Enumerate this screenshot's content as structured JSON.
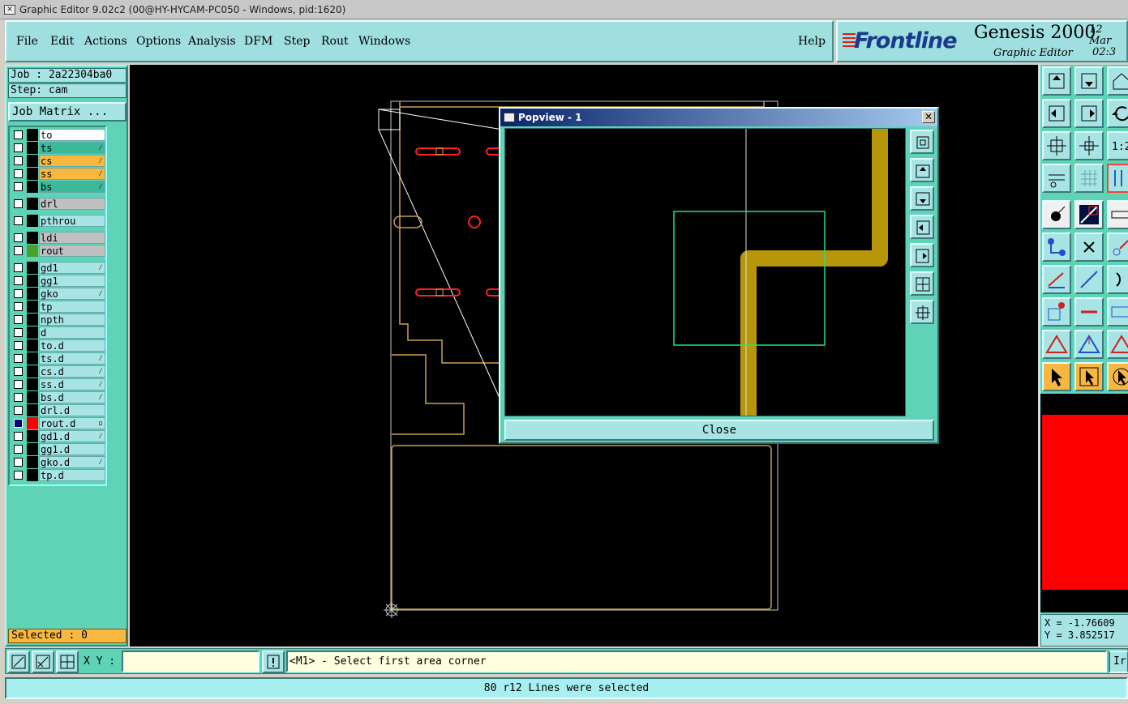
{
  "window": {
    "title": "Graphic Editor 9.02c2 (00@HY-HYCAM-PC050 - Windows, pid:1620)"
  },
  "menu": {
    "items": [
      "File",
      "Edit",
      "Actions",
      "Options",
      "Analysis",
      "DFM",
      "Step",
      "Rout",
      "Windows"
    ],
    "help": "Help"
  },
  "brand": {
    "logo": "Frontline",
    "product": "Genesis 2000",
    "subtitle": "Graphic Editor",
    "date_line1": "12 Mar",
    "date_line2": "02:3"
  },
  "job": {
    "job_label": "Job : 2a22304ba0",
    "step_label": "Step: cam",
    "job_matrix_button": "Job Matrix ..."
  },
  "layers": [
    {
      "name": "to",
      "color": "#000000",
      "bg": "#ffffff",
      "checked": false,
      "flag": ""
    },
    {
      "name": "ts",
      "color": "#000000",
      "bg": "#3cb89a",
      "checked": false,
      "flag": "⁄"
    },
    {
      "name": "cs",
      "color": "#000000",
      "bg": "#f8b840",
      "checked": false,
      "flag": "⁄"
    },
    {
      "name": "ss",
      "color": "#000000",
      "bg": "#f8b840",
      "checked": false,
      "flag": "⁄"
    },
    {
      "name": "bs",
      "color": "#000000",
      "bg": "#3cb89a",
      "checked": false,
      "flag": "⁄"
    },
    {
      "name": "drl",
      "color": "#000000",
      "bg": "#c0c0c0",
      "checked": false,
      "flag": ""
    },
    {
      "name": "pthrou",
      "color": "#000000",
      "bg": "#a8e4e4",
      "checked": false,
      "flag": ""
    },
    {
      "name": "ldi",
      "color": "#000000",
      "bg": "#c0c0c0",
      "checked": false,
      "flag": ""
    },
    {
      "name": "rout",
      "color": "#4aa02a",
      "bg": "#c0c0c0",
      "checked": false,
      "flag": ""
    },
    {
      "name": "gd1",
      "color": "#000000",
      "bg": "#a8e4e4",
      "checked": false,
      "flag": "⁄"
    },
    {
      "name": "gg1",
      "color": "#000000",
      "bg": "#a8e4e4",
      "checked": false,
      "flag": ""
    },
    {
      "name": "gko",
      "color": "#000000",
      "bg": "#a8e4e4",
      "checked": false,
      "flag": "⁄"
    },
    {
      "name": "tp",
      "color": "#000000",
      "bg": "#a8e4e4",
      "checked": false,
      "flag": ""
    },
    {
      "name": "npth",
      "color": "#000000",
      "bg": "#a8e4e4",
      "checked": false,
      "flag": ""
    },
    {
      "name": "d",
      "color": "#000000",
      "bg": "#a8e4e4",
      "checked": false,
      "flag": ""
    },
    {
      "name": "to.d",
      "color": "#000000",
      "bg": "#a8e4e4",
      "checked": false,
      "flag": ""
    },
    {
      "name": "ts.d",
      "color": "#000000",
      "bg": "#a8e4e4",
      "checked": false,
      "flag": "⁄"
    },
    {
      "name": "cs.d",
      "color": "#000000",
      "bg": "#a8e4e4",
      "checked": false,
      "flag": "⁄"
    },
    {
      "name": "ss.d",
      "color": "#000000",
      "bg": "#a8e4e4",
      "checked": false,
      "flag": "⁄"
    },
    {
      "name": "bs.d",
      "color": "#000000",
      "bg": "#a8e4e4",
      "checked": false,
      "flag": "⁄"
    },
    {
      "name": "drl.d",
      "color": "#000000",
      "bg": "#a8e4e4",
      "checked": false,
      "flag": ""
    },
    {
      "name": "rout.d",
      "color": "#ff0000",
      "bg": "#a8e4e4",
      "checked": true,
      "flag": "▫"
    },
    {
      "name": "gd1.d",
      "color": "#000000",
      "bg": "#a8e4e4",
      "checked": false,
      "flag": "⁄"
    },
    {
      "name": "gg1.d",
      "color": "#000000",
      "bg": "#a8e4e4",
      "checked": false,
      "flag": ""
    },
    {
      "name": "gko.d",
      "color": "#000000",
      "bg": "#a8e4e4",
      "checked": false,
      "flag": "⁄"
    },
    {
      "name": "tp.d",
      "color": "#000000",
      "bg": "#a8e4e4",
      "checked": false,
      "flag": ""
    }
  ],
  "selected": "Selected : 0",
  "popview": {
    "title": "Popview - 1",
    "close_label": "Close"
  },
  "coords": {
    "x": "X = -1.76609",
    "y": "Y = 3.852517"
  },
  "input": {
    "xy_label": "X Y :",
    "xy_value": "",
    "prompt": "<M1> - Select first area corner",
    "ir_label": "Ir"
  },
  "status": "80 r12 Lines were selected",
  "colors": {
    "panel": "#5fd3b6",
    "button": "#a8e4e4",
    "highlight": "#f8b840",
    "trace": "#b8960a",
    "outline": "#c8a050"
  }
}
